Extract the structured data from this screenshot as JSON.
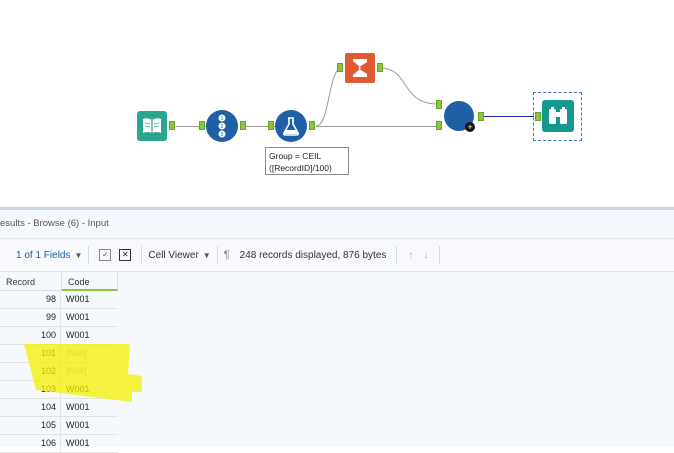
{
  "workflow": {
    "annotation_line1": "Group = CEIL",
    "annotation_line2": "([RecordID]/100)",
    "tools": [
      "book-input-icon",
      "record-id-icon",
      "formula-icon",
      "summarize-icon",
      "join-icon",
      "browse-icon"
    ],
    "colors": {
      "tool_blue": "#1f5fa6",
      "summarize_orange": "#e05a33",
      "browse_teal": "#17988f",
      "port_green": "#8cc63f",
      "output_wire": "#1e2aa8"
    }
  },
  "results": {
    "title": "esults - Browse (6) - Input",
    "fields_label": "1 of 1 Fields",
    "viewer_label": "Cell Viewer",
    "status": "248 records displayed, 876 bytes",
    "columns": [
      "Record",
      "Code"
    ],
    "rows": [
      {
        "record": "98",
        "code": "W001",
        "null": false
      },
      {
        "record": "99",
        "code": "W001",
        "null": false
      },
      {
        "record": "100",
        "code": "W001",
        "null": false
      },
      {
        "record": "101",
        "code": "[Null]",
        "null": true
      },
      {
        "record": "102",
        "code": "[Null]",
        "null": true
      },
      {
        "record": "103",
        "code": "W001",
        "null": false
      },
      {
        "record": "104",
        "code": "W001",
        "null": false
      },
      {
        "record": "105",
        "code": "W001",
        "null": false
      },
      {
        "record": "106",
        "code": "W001",
        "null": false
      }
    ],
    "highlight_color": "#f4f000"
  }
}
